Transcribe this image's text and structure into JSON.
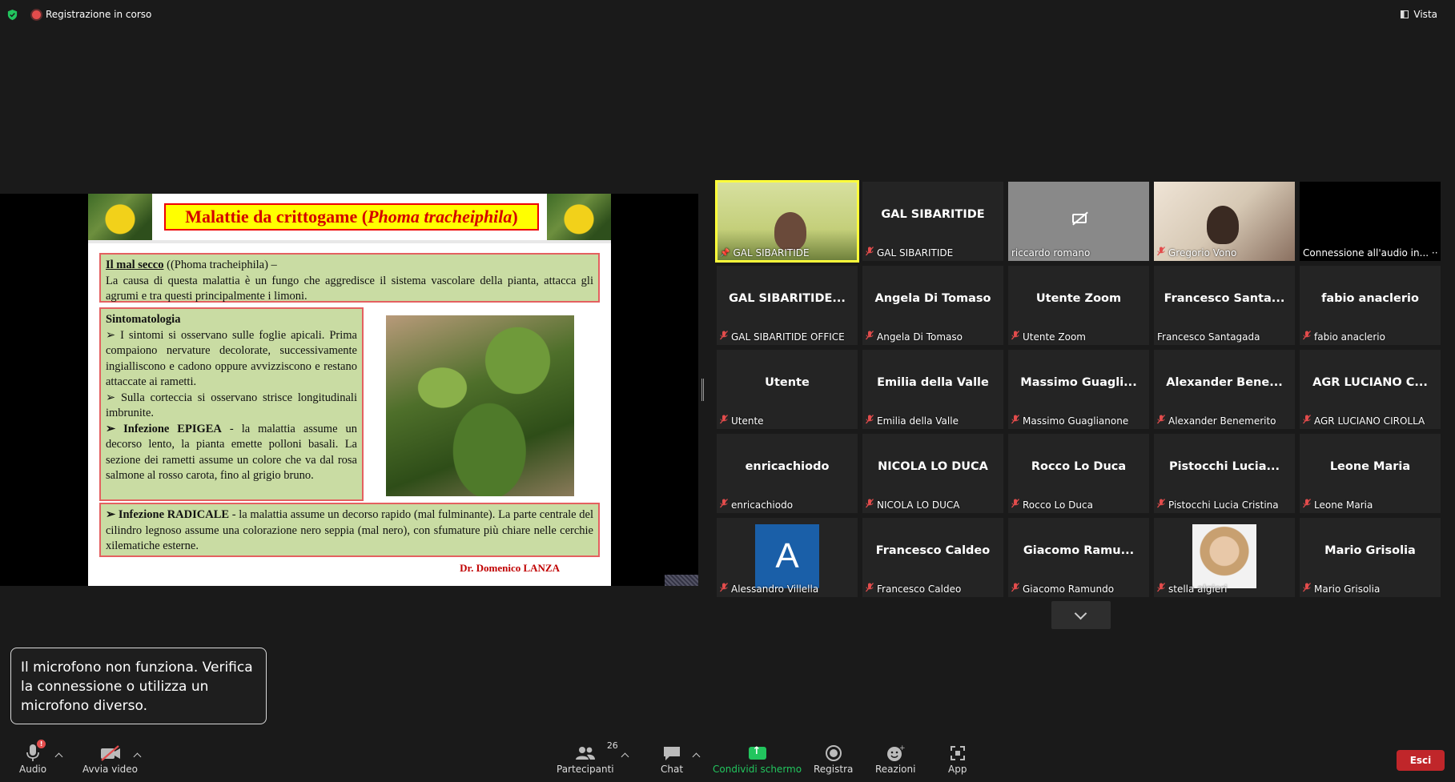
{
  "top": {
    "recording": "Registrazione in corso",
    "view": "Vista"
  },
  "slide": {
    "title_main": "Malattie da crittogame (",
    "title_italic": "Phoma tracheiphila",
    "title_end": ")",
    "box1": {
      "heading": "Il mal secco",
      "heading_rest": " ((Phoma tracheiphila) –",
      "text": "La causa di questa malattia è un fungo che aggredisce il sistema vascolare della pianta, attacca gli agrumi e tra questi principalmente i limoni."
    },
    "box2": {
      "heading": "Sintomatologia",
      "p1": "➢ I sintomi si osservano sulle foglie apicali. Prima compaiono nervature decolorate, successivamente ingialliscono e cadono oppure avvizziscono e restano attaccate ai rametti.",
      "p2": "➢ Sulla corteccia si osservano strisce longitudinali imbrunite.",
      "p3_bold": "➢ Infezione EPIGEA",
      "p3": " - la malattia assume un decorso lento, la pianta emette polloni basali. La sezione dei rametti assume un colore che va dal rosa salmone al rosso carota, fino al grigio bruno."
    },
    "box3": {
      "bold": "➢ Infezione RADICALE",
      "text": " - la malattia assume un decorso rapido (mal fulminante). La parte centrale del cilindro legnoso assume una colorazione nero seppia (mal nero), con sfumature più chiare nelle cerchie xilematiche esterne."
    },
    "author": "Dr. Domenico LANZA"
  },
  "gallery": [
    {
      "name": "",
      "label": "GAL SIBARITIDE",
      "type": "video-gal",
      "muted": false,
      "pinned": true
    },
    {
      "name": "GAL SIBARITIDE",
      "label": "GAL SIBARITIDE",
      "type": "name",
      "muted": true
    },
    {
      "name": "",
      "label": "riccardo romano",
      "type": "camoff",
      "muted": false
    },
    {
      "name": "",
      "label": "Gregorio Vono",
      "type": "video-greg",
      "muted": true
    },
    {
      "name": "",
      "label": "Connessione all'audio in... ··",
      "type": "black",
      "muted": false
    },
    {
      "name": "GAL SIBARITIDE...",
      "label": "GAL SIBARITIDE OFFICE",
      "type": "name",
      "muted": true
    },
    {
      "name": "Angela Di Tomaso",
      "label": "Angela Di Tomaso",
      "type": "name",
      "muted": true
    },
    {
      "name": "Utente Zoom",
      "label": "Utente Zoom",
      "type": "name",
      "muted": true
    },
    {
      "name": "Francesco  Santa...",
      "label": "Francesco Santagada",
      "type": "name",
      "muted": false
    },
    {
      "name": "fabio anaclerio",
      "label": "fabio anaclerio",
      "type": "name",
      "muted": true
    },
    {
      "name": "Utente",
      "label": "Utente",
      "type": "name",
      "muted": true
    },
    {
      "name": "Emilia della Valle",
      "label": "Emilia della Valle",
      "type": "name",
      "muted": true
    },
    {
      "name": "Massimo  Guagli...",
      "label": "Massimo Guaglianone",
      "type": "name",
      "muted": true
    },
    {
      "name": "Alexander  Bene...",
      "label": "Alexander Benemerito",
      "type": "name",
      "muted": true
    },
    {
      "name": "AGR LUCIANO C...",
      "label": "AGR LUCIANO CIROLLA",
      "type": "name",
      "muted": true
    },
    {
      "name": "enricachiodo",
      "label": "enricachiodo",
      "type": "name",
      "muted": true
    },
    {
      "name": "NICOLA LO DUCA",
      "label": "NICOLA LO DUCA",
      "type": "name",
      "muted": true
    },
    {
      "name": "Rocco Lo Duca",
      "label": "Rocco Lo Duca",
      "type": "name",
      "muted": true
    },
    {
      "name": "Pistocchi  Lucia...",
      "label": "Pistocchi Lucia Cristina",
      "type": "name",
      "muted": true
    },
    {
      "name": "Leone Maria",
      "label": "Leone Maria",
      "type": "name",
      "muted": true
    },
    {
      "name": "A",
      "label": "Alessandro Villella",
      "type": "avatar",
      "muted": true
    },
    {
      "name": "Francesco Caldeo",
      "label": "Francesco Caldeo",
      "type": "name",
      "muted": true
    },
    {
      "name": "Giacomo  Ramu...",
      "label": "Giacomo Ramundo",
      "type": "name",
      "muted": true
    },
    {
      "name": "",
      "label": "stella algieri",
      "type": "photo",
      "muted": true
    },
    {
      "name": "Mario Grisolia",
      "label": "Mario Grisolia",
      "type": "name",
      "muted": true
    }
  ],
  "notice": "Il microfono non funziona. Verifica la connessione o utilizza un microfono diverso.",
  "toolbar": {
    "audio": "Audio",
    "video": "Avvia video",
    "participants": "Partecipanti",
    "participants_count": "26",
    "chat": "Chat",
    "share": "Condividi schermo",
    "record": "Registra",
    "reactions": "Reazioni",
    "apps": "App",
    "leave": "Esci"
  },
  "colors": {
    "accent_green": "#22c55e",
    "leave_red": "#c0262a",
    "active_speaker": "#ffff3a"
  }
}
